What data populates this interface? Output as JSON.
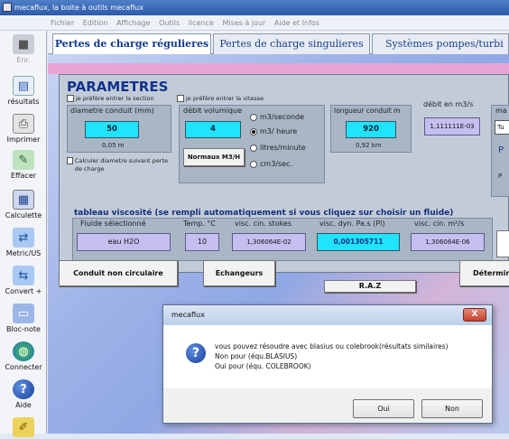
{
  "window": {
    "title": "mecaflux, la boite à outils mecaflux"
  },
  "menu": [
    "Fichier",
    "Edition",
    "Affichage",
    "Outils",
    "licence",
    "Mises à jour",
    "Aide et Infos"
  ],
  "sidebar": [
    {
      "label": "Enr.",
      "icon": "save-icon"
    },
    {
      "label": "résultats",
      "icon": "results-icon"
    },
    {
      "label": "Imprimer",
      "icon": "printer-icon"
    },
    {
      "label": "Effacer",
      "icon": "eraser-icon"
    },
    {
      "label": "Calculette",
      "icon": "calculator-icon"
    },
    {
      "label": "Metric/US",
      "icon": "units-icon"
    },
    {
      "label": "Convert +",
      "icon": "convert-icon"
    },
    {
      "label": "Bloc-note",
      "icon": "notepad-icon"
    },
    {
      "label": "Connecter",
      "icon": "globe-icon"
    },
    {
      "label": "Aide",
      "icon": "help-icon"
    }
  ],
  "tabs": [
    "Pertes de charge régulieres",
    "Pertes de charge singulieres",
    "Systèmes pompes/turbi"
  ],
  "params": {
    "title": "PARAMETRES",
    "check_section": "je préfère entrer la section",
    "check_vitesse": "je préfère entrer la vitesse",
    "diam_label": "diametre  conduit (mm)",
    "diam_value": "50",
    "diam_sub": "0,05 m",
    "calc_diam": "Calculer diametre suivant perte de charge",
    "debit_label": "débit volumique",
    "debit_value": "4",
    "normaux_btn": "Normaux M3/H",
    "radios": [
      "m3/seconde",
      "m3/ heure",
      "litres/minute",
      "cm3/sec."
    ],
    "radio_selected": 1,
    "long_label": "longueur conduit m",
    "long_value": "920",
    "long_sub": "0,92 km",
    "debit_m3s_label": "débit en m3/s",
    "debit_m3s_value": "1,111111E-03",
    "cut_label": "ma",
    "cut_value": "Tu",
    "cut_p1": "P",
    "cut_p2": "P"
  },
  "visc": {
    "title": "tableau viscosité (se rempli automatiquement si vous cliquez sur choisir un fluide)",
    "fluid_label": "Fluide sélectionné",
    "fluid_value": "eau H2O",
    "temp_label": "Temp. °C",
    "temp_value": "10",
    "stokes_label": "visc. cin. stokes",
    "stokes_value": "1,306064E-02",
    "dyn_label": "visc. dyn. Pa.s  (Pl)",
    "dyn_value": "0,001305711",
    "cin_label": "visc. cin. m²/s",
    "cin_value": "1,306064E-06"
  },
  "buttons": {
    "conduit": "Conduit non circulaire",
    "echangeurs": "Echangeurs",
    "raz": "R.A.Z",
    "determ": "Détermin"
  },
  "dialog": {
    "title": "mecaflux",
    "close": "X",
    "line1": "vous pouvez résoudre avec blasius ou colebrook(résultats similaires)",
    "line2": "Non     pour (équ.BLASIUS)",
    "line3": "Oui     pour (équ. COLEBROOK)",
    "oui": "Oui",
    "non": "Non"
  }
}
